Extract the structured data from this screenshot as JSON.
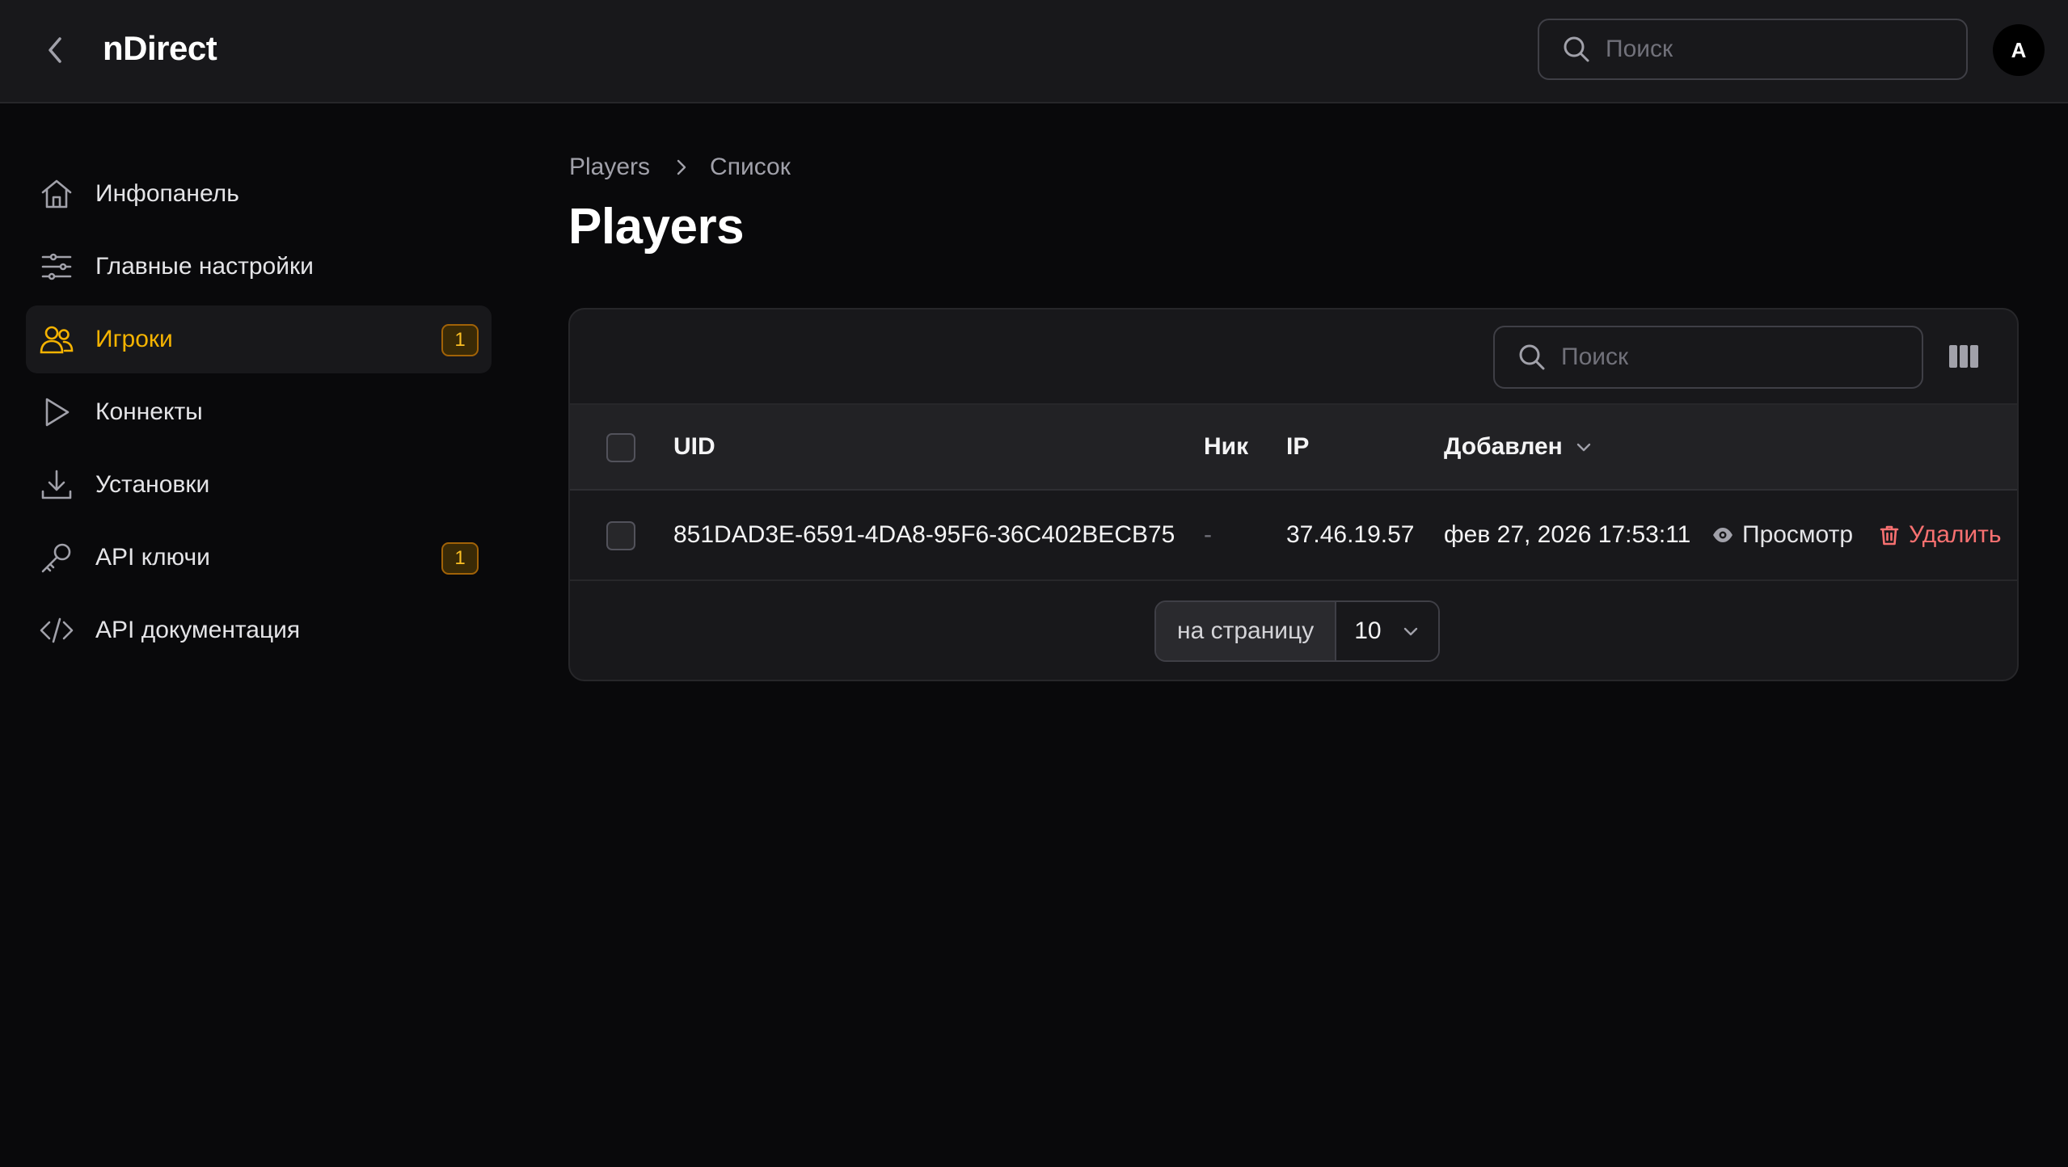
{
  "header": {
    "brand": "nDirect",
    "search_placeholder": "Поиск",
    "avatar_initial": "A"
  },
  "sidebar": {
    "items": [
      {
        "label": "Инфопанель",
        "icon": "home-icon",
        "badge": null,
        "active": false
      },
      {
        "label": "Главные настройки",
        "icon": "sliders-icon",
        "badge": null,
        "active": false
      },
      {
        "label": "Игроки",
        "icon": "users-icon",
        "badge": "1",
        "active": true
      },
      {
        "label": "Коннекты",
        "icon": "play-icon",
        "badge": null,
        "active": false
      },
      {
        "label": "Установки",
        "icon": "download-icon",
        "badge": null,
        "active": false
      },
      {
        "label": "API ключи",
        "icon": "key-icon",
        "badge": "1",
        "active": false
      },
      {
        "label": "API документация",
        "icon": "code-icon",
        "badge": null,
        "active": false
      }
    ]
  },
  "breadcrumb": {
    "parent": "Players",
    "current": "Список"
  },
  "page": {
    "title": "Players"
  },
  "table": {
    "search_placeholder": "Поиск",
    "columns": {
      "uid": "UID",
      "nick": "Ник",
      "ip": "IP",
      "added": "Добавлен"
    },
    "rows": [
      {
        "uid": "851DAD3E-6591-4DA8-95F6-36C402BECB75",
        "nick": "-",
        "ip": "37.46.19.57",
        "added": "фев 27, 2026 17:53:11",
        "view_label": "Просмотр",
        "delete_label": "Удалить"
      }
    ],
    "per_page_label": "на страницу",
    "per_page_value": "10"
  },
  "colors": {
    "accent": "#f5b301",
    "danger": "#f87171",
    "background": "#09090b",
    "surface": "#18181b"
  }
}
